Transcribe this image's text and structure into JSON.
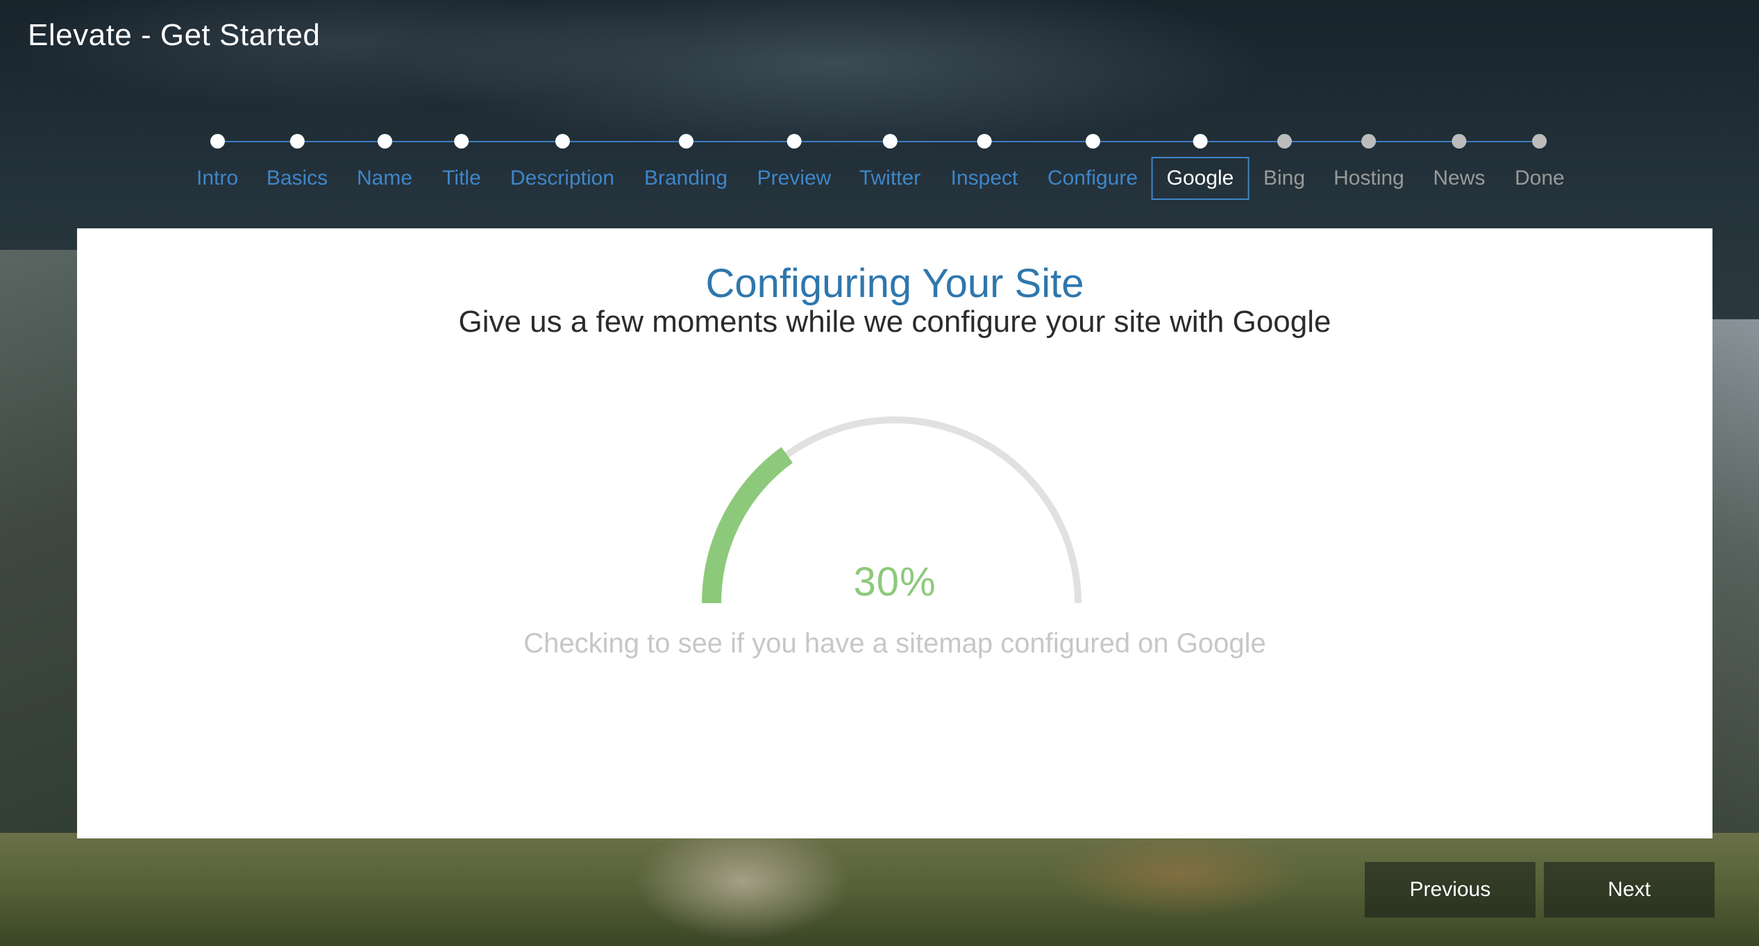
{
  "app": {
    "title": "Elevate - Get Started"
  },
  "wizard": {
    "current_step": "Google",
    "steps": [
      {
        "label": "Intro",
        "state": "completed"
      },
      {
        "label": "Basics",
        "state": "completed"
      },
      {
        "label": "Name",
        "state": "completed"
      },
      {
        "label": "Title",
        "state": "completed"
      },
      {
        "label": "Description",
        "state": "completed"
      },
      {
        "label": "Branding",
        "state": "completed"
      },
      {
        "label": "Preview",
        "state": "completed"
      },
      {
        "label": "Twitter",
        "state": "completed"
      },
      {
        "label": "Inspect",
        "state": "completed"
      },
      {
        "label": "Configure",
        "state": "completed"
      },
      {
        "label": "Google",
        "state": "current"
      },
      {
        "label": "Bing",
        "state": "pending"
      },
      {
        "label": "Hosting",
        "state": "pending"
      },
      {
        "label": "News",
        "state": "pending"
      },
      {
        "label": "Done",
        "state": "pending"
      }
    ]
  },
  "main": {
    "heading": "Configuring Your Site",
    "subheading": "Give us a few moments while we configure your site with Google",
    "progress": {
      "fraction": 0.3,
      "label": "30%"
    },
    "status_text": "Checking to see if you have a sitemap configured on Google"
  },
  "footer": {
    "previous_label": "Previous",
    "next_label": "Next"
  },
  "colors": {
    "accent": "#3f86c9",
    "heading": "#2f77ad",
    "progress": "#8dc97b",
    "track": "#e1e1e1",
    "pending": "#9a9a9a"
  },
  "icons": {
    "step_marker": "circle-dot"
  }
}
